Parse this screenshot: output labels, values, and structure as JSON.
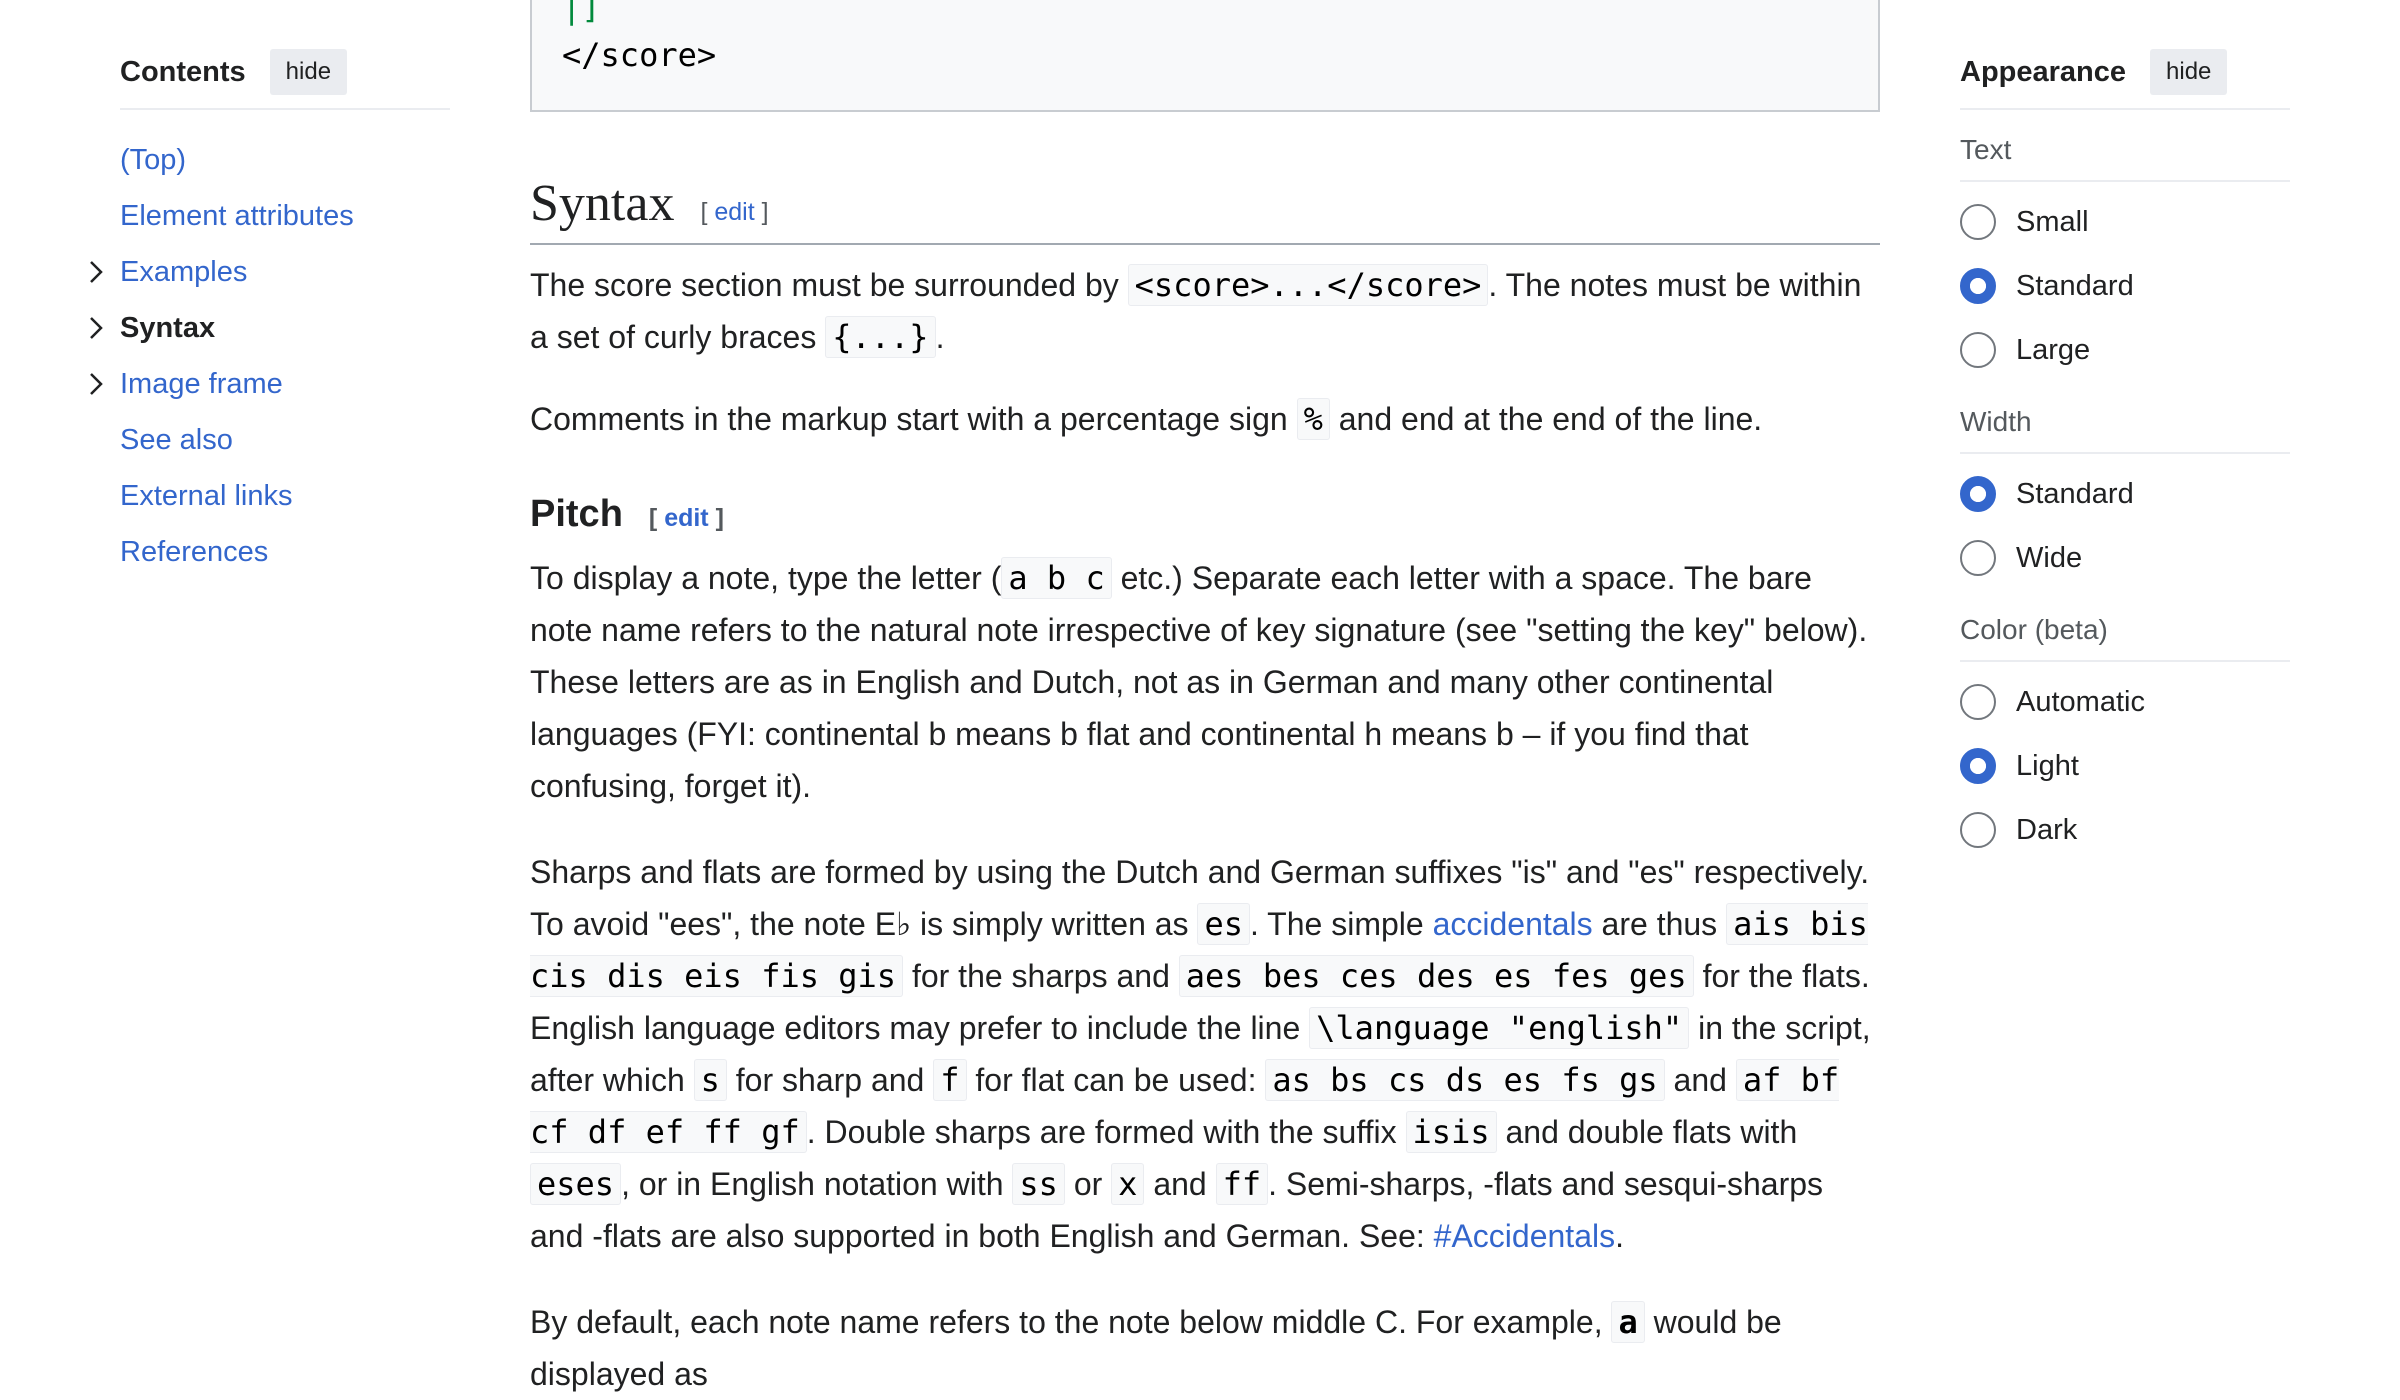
{
  "toc": {
    "title": "Contents",
    "hide_label": "hide",
    "items": [
      {
        "label": "(Top)",
        "expandable": false,
        "active": false
      },
      {
        "label": "Element attributes",
        "expandable": false,
        "active": false
      },
      {
        "label": "Examples",
        "expandable": true,
        "active": false
      },
      {
        "label": "Syntax",
        "expandable": true,
        "active": true
      },
      {
        "label": "Image frame",
        "expandable": true,
        "active": false
      },
      {
        "label": "See also",
        "expandable": false,
        "active": false
      },
      {
        "label": "External links",
        "expandable": false,
        "active": false
      },
      {
        "label": "References",
        "expandable": false,
        "active": false
      }
    ]
  },
  "codeblock": {
    "line1": "|]",
    "line2": "</score>"
  },
  "syntax": {
    "heading": "Syntax",
    "edit_open": "[ ",
    "edit_label": "edit",
    "edit_close": " ]",
    "p1": {
      "t1": "The score section must be surrounded by ",
      "c1": "<score>...</score>",
      "t2": ". The notes must be within a set of curly braces ",
      "c2": "{...}",
      "t3": "."
    },
    "p2": {
      "t1": "Comments in the markup start with a percentage sign ",
      "c1": "%",
      "t2": " and end at the end of the line."
    }
  },
  "pitch": {
    "heading": "Pitch",
    "edit_label": "edit",
    "p1": {
      "t1": "To display a note, type the letter (",
      "c1": "a b c",
      "t2": " etc.) Separate each letter with a space. The bare note name refers to the natural note irrespective of key signature (see \"setting the key\" below). These letters are as in English and Dutch, not as in German and many other continental languages (FYI: continental b means b flat and continental h means b – if you find that confusing, forget it)."
    },
    "p2": {
      "t1": "Sharps and flats are formed by using the Dutch and German suffixes \"is\" and \"es\" respectively. To avoid \"ees\", the note E♭ is simply written as ",
      "c1": "es",
      "t2": ". The simple ",
      "link1": "accidentals",
      "t3": " are thus ",
      "c2": "ais bis cis dis eis fis gis",
      "t4": " for the sharps and ",
      "c3": "aes bes ces des es fes ges",
      "t5": " for the flats. English language editors may prefer to include the line ",
      "c4": "\\language \"english\"",
      "t6": " in the script, after which ",
      "c5": "s",
      "t7": " for sharp and ",
      "c6": "f",
      "t8": " for flat can be used: ",
      "c7": "as bs cs ds es fs gs",
      "t9": " and ",
      "c8": "af bf cf df ef ff gf",
      "t10": ". Double sharps are formed with the suffix ",
      "c9": "isis",
      "t11": " and double flats with ",
      "c10": "eses",
      "t12": ", or in English notation with ",
      "c11": "ss",
      "t13": " or ",
      "c12": "x",
      "t14": " and ",
      "c13": "ff",
      "t15": ". Semi-sharps, -flats and sesqui-sharps and -flats are also supported in both English and German. See: ",
      "link2": "#Accidentals",
      "t16": "."
    },
    "p3": {
      "t1": "By default, each note name refers to the note below middle C. For example, ",
      "c1": "a",
      "t2": " would be displayed as"
    }
  },
  "appearance": {
    "title": "Appearance",
    "hide_label": "hide",
    "groups": [
      {
        "label": "Text",
        "options": [
          {
            "label": "Small",
            "checked": false
          },
          {
            "label": "Standard",
            "checked": true
          },
          {
            "label": "Large",
            "checked": false
          }
        ]
      },
      {
        "label": "Width",
        "options": [
          {
            "label": "Standard",
            "checked": true
          },
          {
            "label": "Wide",
            "checked": false
          }
        ]
      },
      {
        "label": "Color (beta)",
        "options": [
          {
            "label": "Automatic",
            "checked": false
          },
          {
            "label": "Light",
            "checked": true
          },
          {
            "label": "Dark",
            "checked": false
          }
        ]
      }
    ]
  },
  "colors": {
    "link": "#3366cc",
    "radio_checked": "#3366cc",
    "text": "#202122"
  }
}
